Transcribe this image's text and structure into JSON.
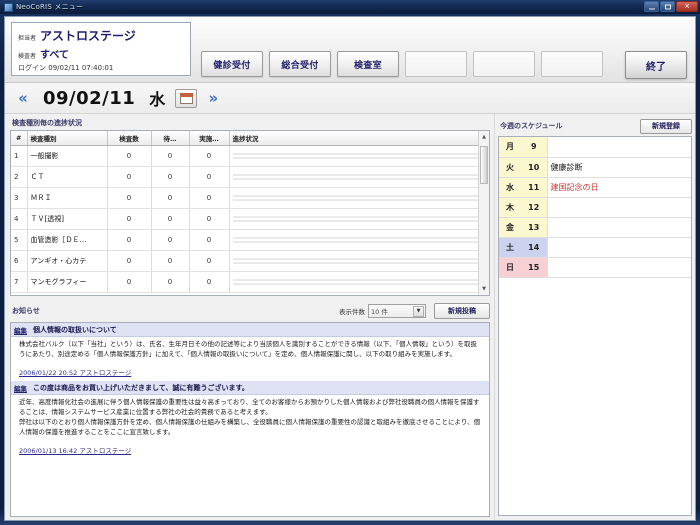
{
  "window": {
    "title": "NeoCoRIS メニュー",
    "controls": {
      "minimize": "–",
      "maximize": "□",
      "close": "✕"
    }
  },
  "user_box": {
    "staff_label": "担当者",
    "staff_value": "アストロステージ",
    "operator_label": "検査者",
    "operator_value": "すべて",
    "login_label": "ログイン",
    "login_value": "09/02/11 07:40:01"
  },
  "toolbar": {
    "buttons": [
      {
        "label": "健診受付",
        "empty": false
      },
      {
        "label": "総合受付",
        "empty": false
      },
      {
        "label": "検査室",
        "empty": false
      },
      {
        "label": "",
        "empty": true
      },
      {
        "label": "",
        "empty": true
      },
      {
        "label": "",
        "empty": true
      }
    ],
    "end_label": "終了"
  },
  "date_bar": {
    "prev": "«",
    "next": "»",
    "date": "09/02/11",
    "weekday": "水",
    "calendar_icon": "calendar-icon"
  },
  "progress_section": {
    "label": "検査種別毎の進捗状況",
    "columns": [
      "#",
      "検査種別",
      "検査数",
      "待…",
      "実施…",
      "進捗状況"
    ],
    "rows": [
      {
        "no": "1",
        "type": "一般撮影",
        "count": "0",
        "waiting": "0",
        "done": "0"
      },
      {
        "no": "2",
        "type": "ＣＴ",
        "count": "0",
        "waiting": "0",
        "done": "0"
      },
      {
        "no": "3",
        "type": "ＭＲＩ",
        "count": "0",
        "waiting": "0",
        "done": "0"
      },
      {
        "no": "4",
        "type": "ＴＶ[透視]",
        "count": "0",
        "waiting": "0",
        "done": "0"
      },
      {
        "no": "5",
        "type": "血管造影［ＤＥ…",
        "count": "0",
        "waiting": "0",
        "done": "0"
      },
      {
        "no": "6",
        "type": "アンギオ・心カテ",
        "count": "0",
        "waiting": "0",
        "done": "0"
      },
      {
        "no": "7",
        "type": "マンモグラフィー",
        "count": "0",
        "waiting": "0",
        "done": "0"
      }
    ]
  },
  "notices": {
    "label": "お知らせ",
    "count_label": "表示件数",
    "count_value": "10 件",
    "new_post_label": "新規投稿",
    "edit_label": "編集",
    "items": [
      {
        "subject": "個人情報の取扱いについて",
        "body": [
          "株式会社バルク（以下「当社」という）は、氏名、生年月日その他の記述等により当該個人を識別することができる情報（以下、「個人情報」という）を取扱うにあたり、別途定める「個人情報保護方針」に加えて、「個人情報の取扱いについて」を定め、個人情報保護に関し、以下の取り組みを実施します。"
        ],
        "date": "2006/01/22 20:52 アストロステージ"
      },
      {
        "subject": "この度は商品をお買い上げいただきまして、誠に有難うございます。",
        "body": [
          "近年、高度情報化社会の進展に伴う個人情報保護の重要性は益々高まっており、全てのお客様からお預かりした個人情報および弊社役職員の個人情報を保護することは、情報システムサービス産業に位置する弊社の社会的責務であると考えます。",
          "弊社は以下のとおり個人情報保護方針を定め、個人情報保護の仕組みを構築し、全役職員に個人情報保護の重要性の認識と取組みを徹底させることにより、個人情報の保護を推進することをここに宣言致します。"
        ],
        "date": "2006/01/13 16:42 アストロステージ"
      }
    ]
  },
  "schedule": {
    "label": "今週のスケジュール",
    "new_label": "新規登録",
    "rows": [
      {
        "dow": "月",
        "day": "9",
        "event": "",
        "kind": "weekday",
        "holiday": false
      },
      {
        "dow": "火",
        "day": "10",
        "event": "健康診断",
        "kind": "weekday",
        "holiday": false
      },
      {
        "dow": "水",
        "day": "11",
        "event": "建国記念の日",
        "kind": "weekday",
        "holiday": true
      },
      {
        "dow": "木",
        "day": "12",
        "event": "",
        "kind": "weekday",
        "holiday": false
      },
      {
        "dow": "金",
        "day": "13",
        "event": "",
        "kind": "weekday",
        "holiday": false
      },
      {
        "dow": "土",
        "day": "14",
        "event": "",
        "kind": "sat",
        "holiday": false
      },
      {
        "dow": "日",
        "day": "15",
        "event": "",
        "kind": "sun",
        "holiday": false
      }
    ]
  },
  "colors": {
    "accent": "#20205e",
    "holiday": "#d03030",
    "weekday_bg": "#fbf8cf",
    "saturday_bg": "#ccd3ef",
    "sunday_bg": "#f8cfd3",
    "notice_bar_bg": "#dfe2f2"
  }
}
